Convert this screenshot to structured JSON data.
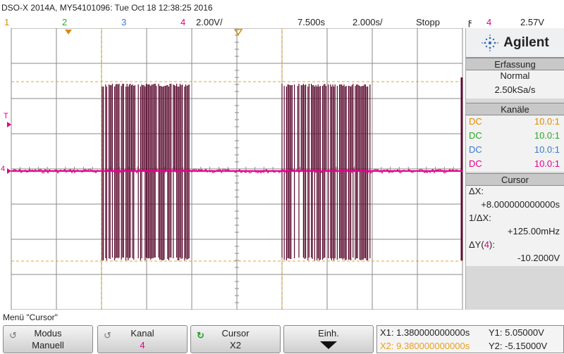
{
  "header": {
    "instrument": "DSO-X 2014A, MY54101096: Tue Oct 18 12:38:25 2016",
    "ch4_num": "4",
    "ch4_scale": "2.00V/",
    "delay": "7.500s",
    "timebase": "2.000s/",
    "run_state": "Stopp",
    "trigger_symbol": "ϝ",
    "trigger_channel": "4",
    "trigger_level": "2.57V"
  },
  "channel_labels": [
    "1",
    "2",
    "3"
  ],
  "colors": {
    "ch1": "#e08a00",
    "ch2": "#2aa52a",
    "ch3": "#3a78d0",
    "ch4": "#e2008a",
    "signal": "#5a0a2e",
    "cursor": "#e8a020",
    "grid": "#8a8a8a"
  },
  "panel": {
    "brand": "Agilent",
    "acq_title": "Erfassung",
    "acq_mode": "Normal",
    "acq_rate": "2.50kSa/s",
    "channels_title": "Kanäle",
    "channels": [
      {
        "coupling": "DC",
        "probe": "10.0:1",
        "color": "#e08a00"
      },
      {
        "coupling": "DC",
        "probe": "10.0:1",
        "color": "#2aa52a"
      },
      {
        "coupling": "DC",
        "probe": "10.0:1",
        "color": "#3a78d0"
      },
      {
        "coupling": "DC",
        "probe": "10.0:1",
        "color": "#e2008a"
      }
    ],
    "cursor_title": "Cursor",
    "dx_label": "ΔX:",
    "dx_value": "+8.000000000000s",
    "inv_dx_label": "1/ΔX:",
    "inv_dx_value": "+125.00mHz",
    "dy_label_prefix": "ΔY(",
    "dy_channel": "4",
    "dy_label_suffix": "):",
    "dy_value": "-10.2000V"
  },
  "menu": {
    "title": "Menü \"Cursor\"",
    "softkeys": [
      {
        "label": "Modus",
        "value": "Manuell"
      },
      {
        "label": "Kanal",
        "value": "4"
      },
      {
        "label": "Cursor",
        "value": "X2"
      },
      {
        "label": "Einh.",
        "value": ""
      }
    ]
  },
  "cursor_readout": {
    "x1": "X1: 1.380000000000s",
    "x2": "X2: 9.380000000000s",
    "y1": "Y1: 5.05000V",
    "y2": "Y2: -5.15000V"
  },
  "markers": {
    "trigger_level_marker": "T",
    "ch4_ground_marker": "4"
  }
}
